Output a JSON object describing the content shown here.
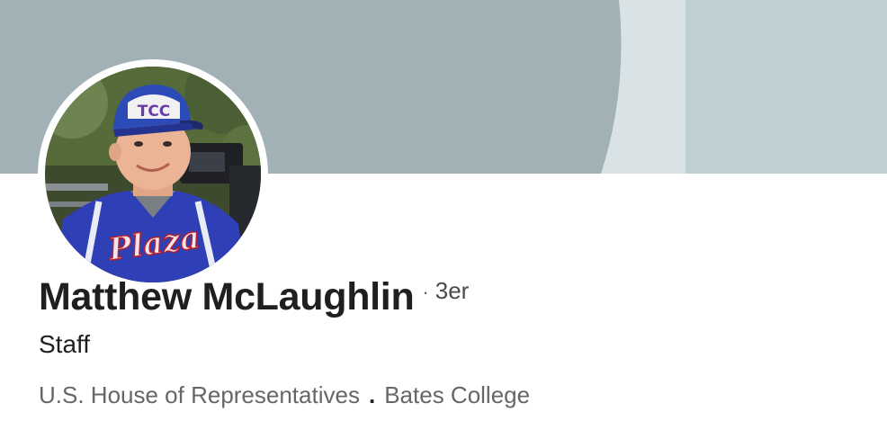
{
  "profile": {
    "name": "Matthew McLaughlin",
    "degree_separator": "·",
    "degree": "3er",
    "headline": "Staff",
    "company": "U.S. House of Representatives",
    "affiliation_separator": ".",
    "school": "Bates College"
  },
  "avatar": {
    "cap_text": "TCC",
    "jersey_text": "Plaza"
  },
  "colors": {
    "banner_dark": "#a1b1b5",
    "banner_mid": "#d9e2e5",
    "banner_light": "#bfd0d4",
    "name": "#1f1f1f",
    "secondary_text": "#666666",
    "jersey_blue": "#2f3fb5",
    "cap_blue": "#2c4bb7"
  }
}
